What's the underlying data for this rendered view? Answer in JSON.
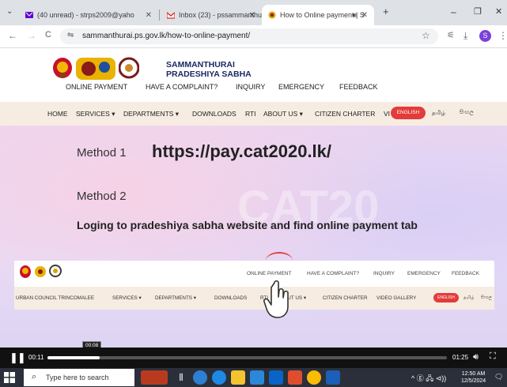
{
  "browser": {
    "tabs": [
      {
        "title": "(40 unread) - strps2009@yaho",
        "icon": "yahoo-mail-icon"
      },
      {
        "title": "Inbox (23) - pssammanthurai@",
        "icon": "gmail-icon"
      },
      {
        "title": "How to Online payment | S",
        "icon": "site-emblem-icon",
        "active": true
      }
    ],
    "new_tab": "+",
    "url": "sammanthurai.ps.gov.lk/how-to-online-payment/",
    "window_controls": {
      "minimize": "–",
      "restore": "❐",
      "close": "✕"
    },
    "nav": {
      "back": "←",
      "forward": "→",
      "reload": "C"
    },
    "toolbar_right": {
      "star": "☆",
      "tune": "⚟",
      "download": "⤓",
      "profile": "S",
      "menu": "⋮"
    }
  },
  "site": {
    "title_line1": "SAMMANTHURAI",
    "title_line2": "PRADESHIYA SABHA",
    "top_nav": [
      "ONLINE PAYMENT",
      "HAVE A COMPLAINT?",
      "INQUIRY",
      "EMERGENCY",
      "FEEDBACK"
    ],
    "main_nav": [
      "HOME",
      "SERVICES ▾",
      "DEPARTMENTS ▾",
      "DOWNLOADS",
      "RTI",
      "ABOUT US ▾",
      "CITIZEN CHARTER",
      "VI"
    ],
    "lang": {
      "english": "ENGLISH",
      "tamil": "தமிழ்",
      "sinhala": "සිංහල"
    }
  },
  "video": {
    "method1_label": "Method 1",
    "method1_url": "https://pay.cat2020.lk/",
    "method2_label": "Method 2",
    "method2_desc": "Loging to pradeshiya sabha website and find online payment tab",
    "watermark": "CAT20",
    "inner_site": {
      "top_nav": [
        "ONLINE PAYMENT",
        "HAVE A COMPLAINT?",
        "INQUIRY",
        "EMERGENCY",
        "FEEDBACK"
      ],
      "main_nav": [
        "URBAN COUNCIL TRINCOMALEE",
        "SERVICES ▾",
        "DEPARTMENTS ▾",
        "DOWNLOADS",
        "RTI",
        "ABOUT US ▾",
        "CITIZEN CHARTER",
        "VIDEO GALLERY"
      ],
      "lang": {
        "english": "ENGLISH",
        "tamil": "தமிழ்",
        "sinhala": "සිංහල"
      }
    },
    "controls": {
      "current_time": "00:11",
      "hover_time": "00:08",
      "duration": "01:25",
      "progress": 0.13
    }
  },
  "taskbar": {
    "search_placeholder": "Type here to search",
    "time": "12:50 AM",
    "date": "12/5/2024",
    "tray": "^ ⓖ 🖧 ⊲))"
  }
}
